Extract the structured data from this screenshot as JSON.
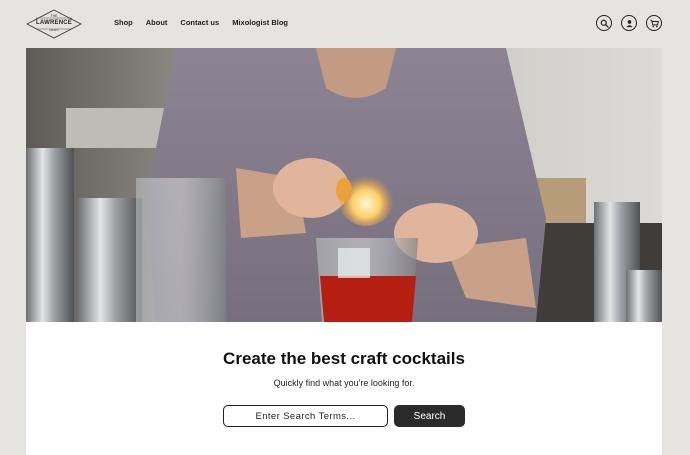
{
  "brand": {
    "logo_top": "THE",
    "logo_name": "LAWRENCE",
    "logo_bottom": "CRAFT",
    "logo_alt": "The Lawrence Craft logo"
  },
  "nav": {
    "items": [
      {
        "label": "Shop"
      },
      {
        "label": "About"
      },
      {
        "label": "Contact us"
      },
      {
        "label": "Mixologist Blog"
      }
    ]
  },
  "header_icons": [
    "search-icon",
    "account-icon",
    "cart-icon"
  ],
  "hero": {
    "image_alt": "Bartender flaming an orange peel over a red cocktail"
  },
  "main": {
    "headline": "Create the best craft cocktails",
    "subhead": "Quickly find what you're looking for.",
    "search": {
      "placeholder": "Enter Search Terms...",
      "value": "",
      "button_label": "Search"
    }
  },
  "colors": {
    "page_background": "#e6e4e0",
    "panel_background": "#ffffff",
    "button_background": "#2a2a2a",
    "text": "#1a1a1a"
  }
}
